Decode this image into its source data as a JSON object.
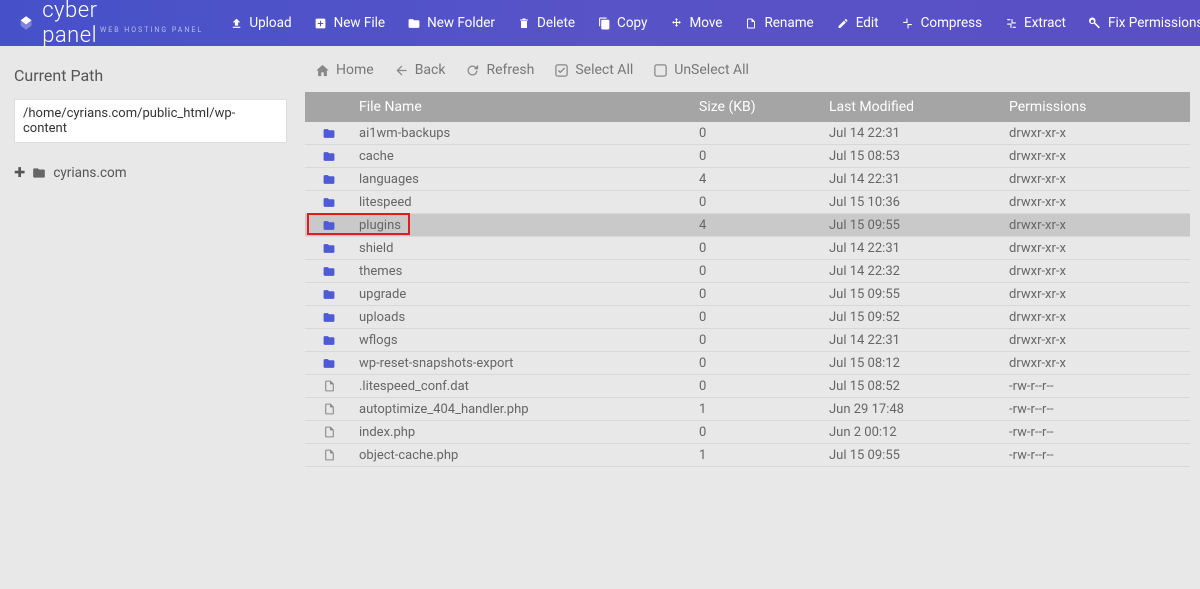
{
  "brand": {
    "name": "cyber panel",
    "tagline": "WEB HOSTING PANEL"
  },
  "toolbar": {
    "upload": "Upload",
    "newfile": "New File",
    "newfolder": "New Folder",
    "delete": "Delete",
    "copy": "Copy",
    "move": "Move",
    "rename": "Rename",
    "edit": "Edit",
    "compress": "Compress",
    "extract": "Extract",
    "fixperms": "Fix Permissions"
  },
  "sidebar": {
    "title": "Current Path",
    "path": "/home/cyrians.com/public_html/wp-content",
    "tree_root": "cyrians.com"
  },
  "nav": {
    "home": "Home",
    "back": "Back",
    "refresh": "Refresh",
    "selectall": "Select All",
    "unselectall": "UnSelect All"
  },
  "headers": {
    "filename": "File Name",
    "size": "Size (KB)",
    "modified": "Last Modified",
    "perms": "Permissions"
  },
  "highlight_index": 4,
  "files": [
    {
      "icon": "folder",
      "name": "ai1wm-backups",
      "size": "0",
      "mod": "Jul 14 22:31",
      "perm": "drwxr-xr-x"
    },
    {
      "icon": "folder",
      "name": "cache",
      "size": "0",
      "mod": "Jul 15 08:53",
      "perm": "drwxr-xr-x"
    },
    {
      "icon": "folder",
      "name": "languages",
      "size": "4",
      "mod": "Jul 14 22:31",
      "perm": "drwxr-xr-x"
    },
    {
      "icon": "folder",
      "name": "litespeed",
      "size": "0",
      "mod": "Jul 15 10:36",
      "perm": "drwxr-xr-x"
    },
    {
      "icon": "folder",
      "name": "plugins",
      "size": "4",
      "mod": "Jul 15 09:55",
      "perm": "drwxr-xr-x"
    },
    {
      "icon": "folder",
      "name": "shield",
      "size": "0",
      "mod": "Jul 14 22:31",
      "perm": "drwxr-xr-x"
    },
    {
      "icon": "folder",
      "name": "themes",
      "size": "0",
      "mod": "Jul 14 22:32",
      "perm": "drwxr-xr-x"
    },
    {
      "icon": "folder",
      "name": "upgrade",
      "size": "0",
      "mod": "Jul 15 09:55",
      "perm": "drwxr-xr-x"
    },
    {
      "icon": "folder",
      "name": "uploads",
      "size": "0",
      "mod": "Jul 15 09:52",
      "perm": "drwxr-xr-x"
    },
    {
      "icon": "folder",
      "name": "wflogs",
      "size": "0",
      "mod": "Jul 14 22:31",
      "perm": "drwxr-xr-x"
    },
    {
      "icon": "folder",
      "name": "wp-reset-snapshots-export",
      "size": "0",
      "mod": "Jul 15 08:12",
      "perm": "drwxr-xr-x"
    },
    {
      "icon": "file",
      "name": ".litespeed_conf.dat",
      "size": "0",
      "mod": "Jul 15 08:52",
      "perm": "-rw-r--r--"
    },
    {
      "icon": "file",
      "name": "autoptimize_404_handler.php",
      "size": "1",
      "mod": "Jun 29 17:48",
      "perm": "-rw-r--r--"
    },
    {
      "icon": "file",
      "name": "index.php",
      "size": "0",
      "mod": "Jun 2 00:12",
      "perm": "-rw-r--r--"
    },
    {
      "icon": "file",
      "name": "object-cache.php",
      "size": "1",
      "mod": "Jul 15 09:55",
      "perm": "-rw-r--r--"
    }
  ]
}
